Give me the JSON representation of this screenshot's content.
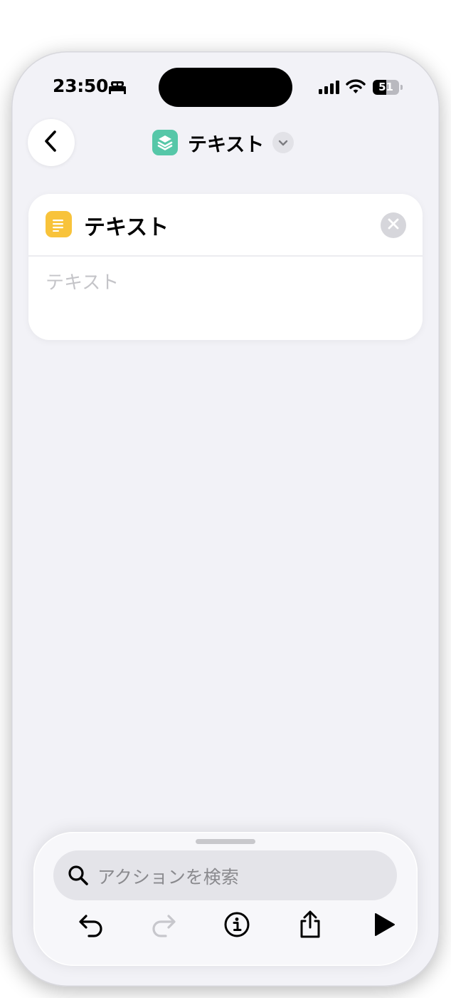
{
  "status_bar": {
    "time": "23:50",
    "battery_level": "51",
    "battery_fraction": 0.51
  },
  "icons": {
    "sleep": "bed-icon",
    "signal": "cellular-signal-icon",
    "wifi": "wifi-icon",
    "back": "chevron-left-icon",
    "app": "shortcut-layers-icon",
    "title_menu": "chevron-down-icon",
    "text_action": "text-lines-icon",
    "clear": "xmark-circle-icon",
    "search": "magnifying-glass-icon",
    "undo": "undo-arrow-icon",
    "redo": "redo-arrow-icon",
    "info": "info-circle-icon",
    "share": "share-icon",
    "run": "play-icon"
  },
  "nav": {
    "title": "テキスト"
  },
  "action_card": {
    "title": "テキスト",
    "input_placeholder": "テキスト"
  },
  "search": {
    "placeholder": "アクションを検索"
  },
  "toolbar": {
    "redo_enabled": false
  },
  "colors": {
    "app_icon": "#56c7a8",
    "text_action_icon": "#f8c33b",
    "background": "#f2f2f7"
  }
}
